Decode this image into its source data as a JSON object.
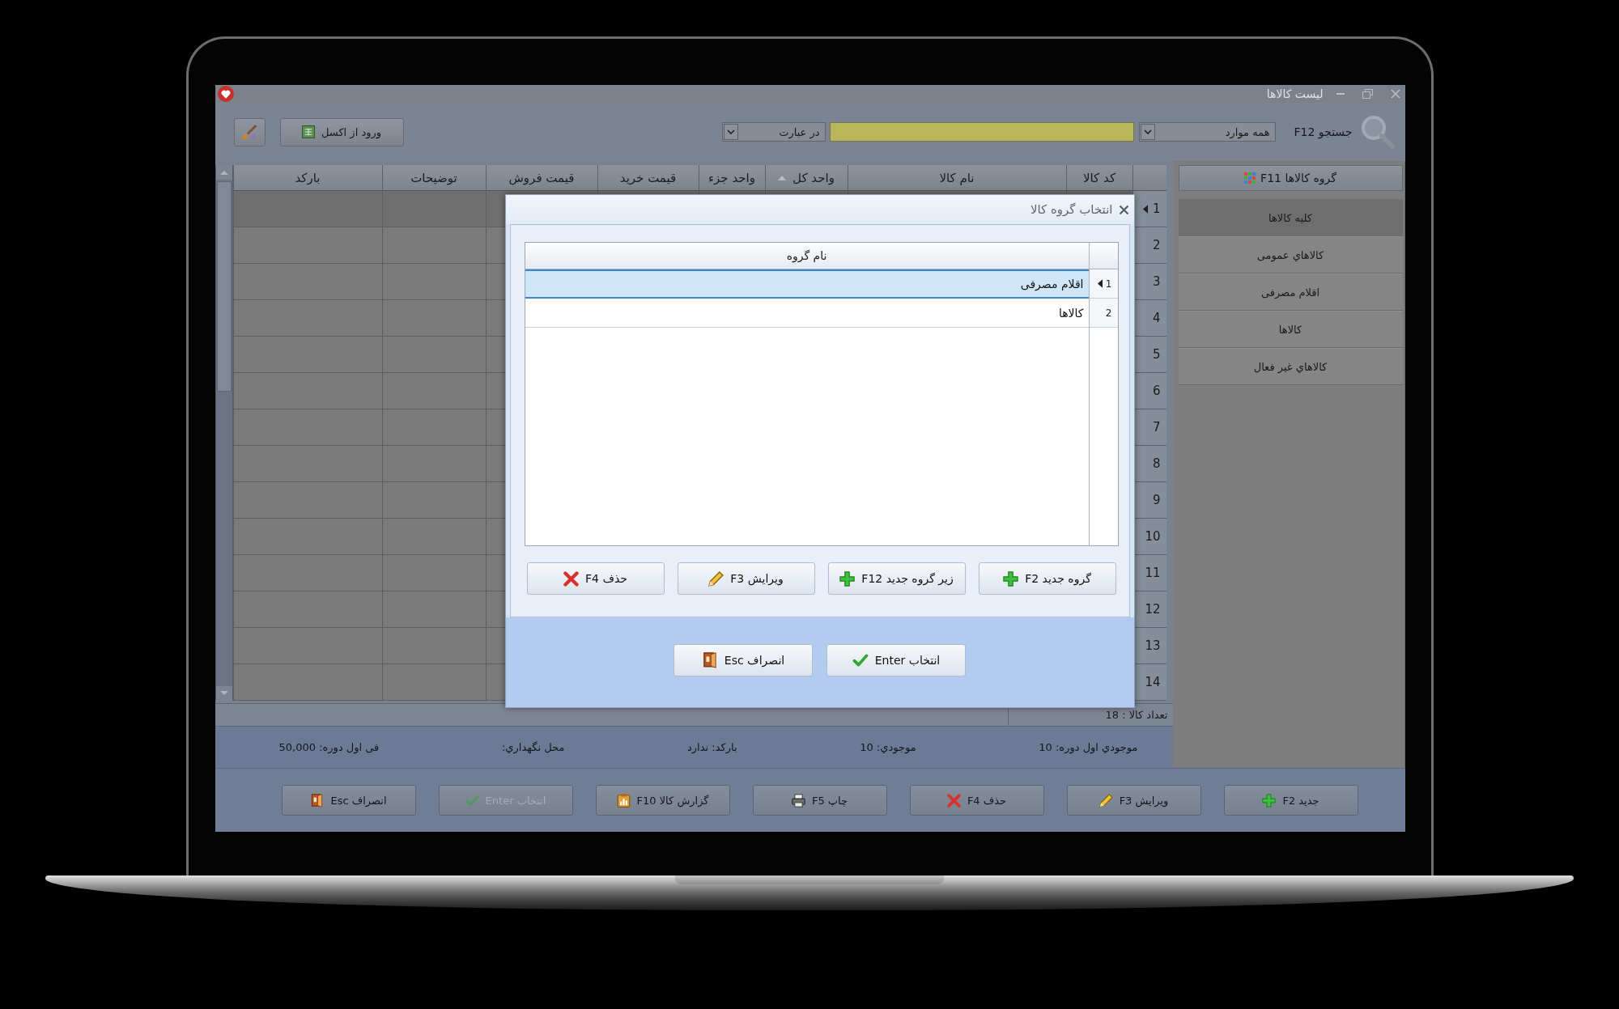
{
  "window": {
    "title": "لیست کالاها"
  },
  "toolbar": {
    "search_label": "جستجو F12",
    "scope": "همه موارد",
    "match": "در عبارت",
    "import_button": "ورود از اکسل"
  },
  "sidebar": {
    "header": "گروه کالاها F11",
    "items": [
      {
        "label": "کلیه کالاها",
        "selected": true
      },
      {
        "label": "کالاهاي عمومی",
        "selected": false
      },
      {
        "label": "اقلام مصرفی",
        "selected": false
      },
      {
        "label": "کالاها",
        "selected": false
      },
      {
        "label": "کالاهاي غیر فعال",
        "selected": false
      }
    ]
  },
  "table": {
    "columns": [
      {
        "label": "کد کالا",
        "sorted": false
      },
      {
        "label": "نام کالا",
        "sorted": false
      },
      {
        "label": "واحد کل",
        "sorted": true
      },
      {
        "label": "واحد جزء",
        "sorted": false
      },
      {
        "label": "قیمت خرید",
        "sorted": false
      },
      {
        "label": "قیمت فروش",
        "sorted": false
      },
      {
        "label": "توضیحات",
        "sorted": false
      },
      {
        "label": "بارکد",
        "sorted": false
      }
    ],
    "rows": [
      {
        "number": "1",
        "selected": true
      },
      {
        "number": "2",
        "selected": false
      },
      {
        "number": "3",
        "selected": false
      },
      {
        "number": "4",
        "selected": false
      },
      {
        "number": "5",
        "selected": false
      },
      {
        "number": "6",
        "selected": false
      },
      {
        "number": "7",
        "selected": false
      },
      {
        "number": "8",
        "selected": false
      },
      {
        "number": "9",
        "selected": false
      },
      {
        "number": "10",
        "selected": false
      },
      {
        "number": "11",
        "selected": false
      },
      {
        "number": "12",
        "selected": false
      },
      {
        "number": "13",
        "selected": false
      },
      {
        "number": "14",
        "selected": false
      }
    ]
  },
  "status": {
    "count": "تعداد کالا : 18"
  },
  "details": [
    "موجودي اول دوره: 10",
    "موجودي: 10",
    "بارکد: ندارد",
    "محل نگهداري:",
    "فی اول دوره: 50,000"
  ],
  "actions": [
    {
      "label": "جدید F2",
      "kind": "add",
      "disabled": false
    },
    {
      "label": "ویرایش F3",
      "kind": "edit",
      "disabled": false
    },
    {
      "label": "حذف F4",
      "kind": "delete",
      "disabled": false
    },
    {
      "label": "چاپ F5",
      "kind": "print",
      "disabled": false
    },
    {
      "label": "گزارش کالا F10",
      "kind": "report",
      "disabled": false
    },
    {
      "label": "انتخاب Enter",
      "kind": "select",
      "disabled": true
    },
    {
      "label": "انصراف Esc",
      "kind": "cancel",
      "disabled": false
    }
  ],
  "dialog": {
    "title": "انتخاب گروه کالا",
    "column": "نام گروه",
    "rows": [
      {
        "number": "1",
        "name": "اقلام مصرفی",
        "selected": true
      },
      {
        "number": "2",
        "name": "کالاها",
        "selected": false
      }
    ],
    "buttons": [
      {
        "label": "گروه جدید F2",
        "kind": "add"
      },
      {
        "label": "زیر گروه جدید F12",
        "kind": "add"
      },
      {
        "label": "ویرایش F3",
        "kind": "edit"
      },
      {
        "label": "حذف F4",
        "kind": "delete"
      }
    ],
    "footer_buttons": [
      {
        "label": "انتخاب Enter",
        "kind": "select"
      },
      {
        "label": "انصراف Esc",
        "kind": "cancel"
      }
    ]
  }
}
